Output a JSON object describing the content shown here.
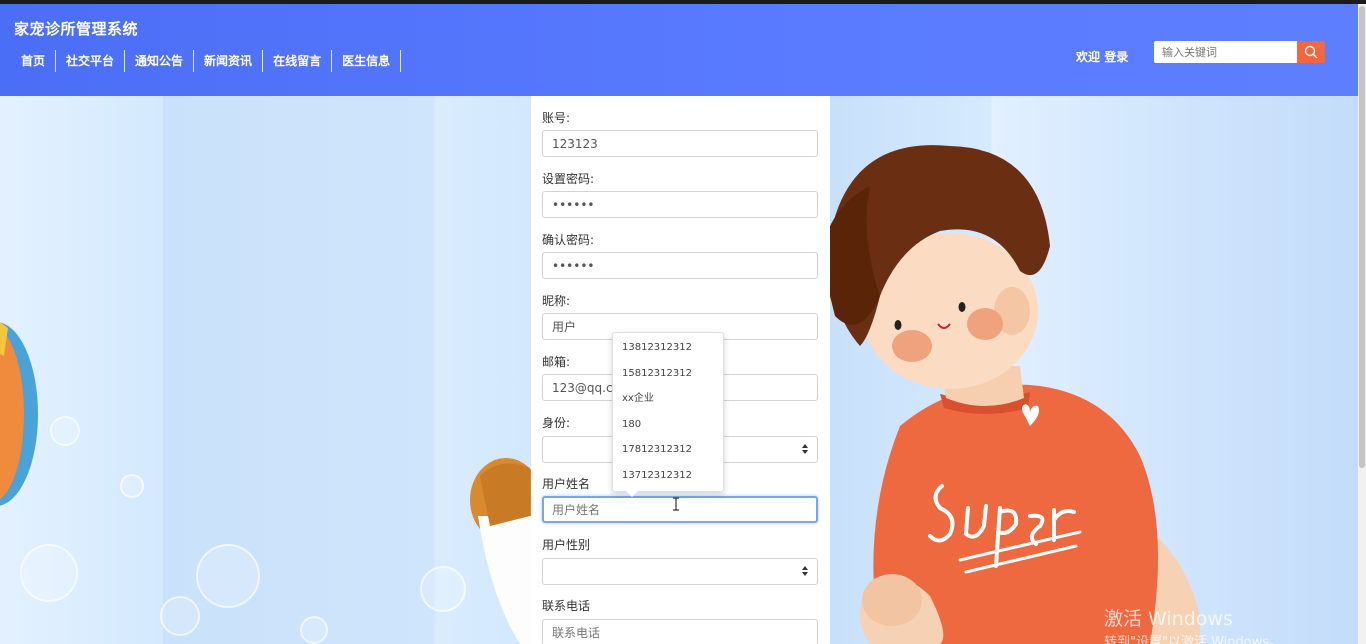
{
  "header": {
    "brand": "家宠诊所管理系统",
    "nav": [
      "首页",
      "社交平台",
      "通知公告",
      "新闻资讯",
      "在线留言",
      "医生信息"
    ],
    "welcome": "欢迎",
    "login": "登录",
    "search_placeholder": "输入关键词"
  },
  "form": {
    "account_label": "账号:",
    "account_value": "123123",
    "password_label": "设置密码:",
    "password_value": "123123",
    "confirm_label": "确认密码:",
    "confirm_value": "123123",
    "nickname_label": "昵称:",
    "nickname_value": "用户",
    "email_label": "邮箱:",
    "email_value": "123@qq.com",
    "identity_label": "身份:",
    "identity_value": "",
    "realname_label": "用户姓名",
    "realname_placeholder": "用户姓名",
    "gender_label": "用户性别",
    "gender_value": "",
    "phone_label": "联系电话",
    "phone_placeholder": "联系电话"
  },
  "autocomplete": {
    "items": [
      "13812312312",
      "15812312312",
      "xx企业",
      "180",
      "17812312312",
      "13712312312"
    ]
  },
  "watermark": {
    "line1": "激活 Windows",
    "line2": "转到\"设置\"以激活 Windows。"
  },
  "colors": {
    "header_blue": "#5a7bff",
    "search_button": "#f4663c",
    "shirt": "#ee6840"
  }
}
